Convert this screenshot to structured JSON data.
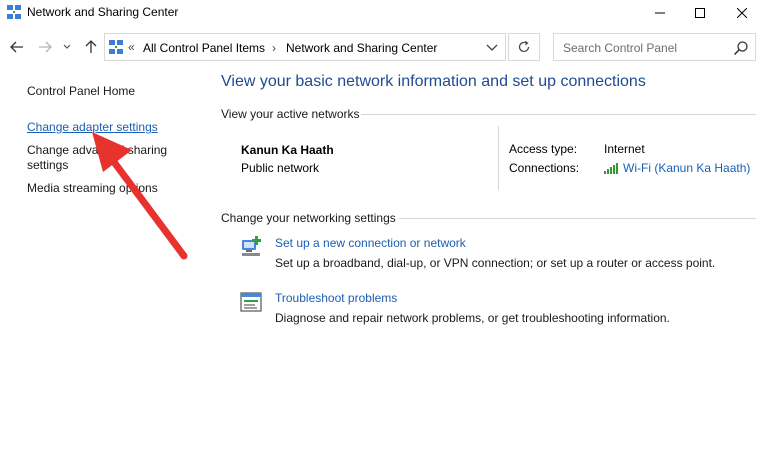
{
  "window": {
    "title": "Network and Sharing Center"
  },
  "nav": {
    "breadcrumb_prefix": "«",
    "crumbs": [
      "All Control Panel Items",
      "Network and Sharing Center"
    ],
    "separator": "›",
    "search_placeholder": "Search Control Panel"
  },
  "sidebar": {
    "home": "Control Panel Home",
    "links": [
      "Change adapter settings",
      "Change advanced sharing settings",
      "Media streaming options"
    ]
  },
  "main": {
    "title": "View your basic network information and set up connections",
    "active_networks_label": "View your active networks",
    "network": {
      "name": "Kanun Ka Haath",
      "type": "Public network",
      "access_type_label": "Access type:",
      "access_type_value": "Internet",
      "connections_label": "Connections:",
      "connection_link": "Wi-Fi (Kanun Ka Haath)"
    },
    "settings_label": "Change your networking settings",
    "tasks": [
      {
        "link": "Set up a new connection or network",
        "desc": "Set up a broadband, dial-up, or VPN connection; or set up a router or access point.",
        "icon": "new-connection-icon"
      },
      {
        "link": "Troubleshoot problems",
        "desc": "Diagnose and repair network problems, or get troubleshooting information.",
        "icon": "troubleshoot-icon"
      }
    ]
  },
  "colors": {
    "link": "#1a5fb4",
    "title": "#1e4b8f",
    "annotation_arrow": "#e8322e"
  }
}
